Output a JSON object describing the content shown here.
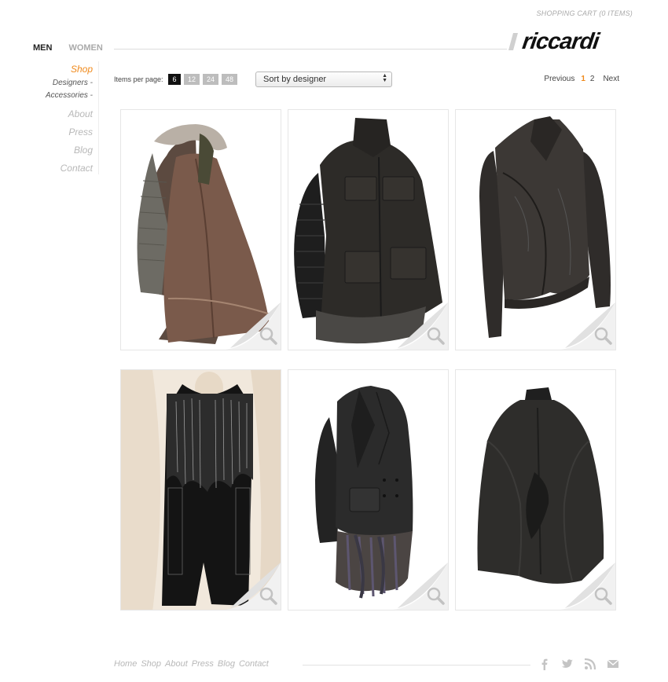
{
  "header": {
    "cart_label": "SHOPPING CART (0 ITEMS)",
    "tabs": [
      {
        "label": "MEN",
        "active": true
      },
      {
        "label": "WOMEN",
        "active": false
      }
    ],
    "logo_text": "riccardi"
  },
  "sidebar": {
    "shop": "Shop",
    "sub_items": [
      "Designers -",
      "Accessories -"
    ],
    "items": [
      "About",
      "Press",
      "Blog",
      "Contact"
    ]
  },
  "toolbar": {
    "ipp_label": "Items per page:",
    "ipp_options": [
      "6",
      "12",
      "24",
      "48"
    ],
    "ipp_selected": "6",
    "sort_value": "Sort by designer",
    "pager": {
      "previous": "Previous",
      "pages": [
        "1",
        "2"
      ],
      "current": "1",
      "next": "Next"
    }
  },
  "products": [
    {
      "garment": "fur-hood-layered-coat",
      "palette": "brown"
    },
    {
      "garment": "utility-jacket-knit-sleeves",
      "palette": "black"
    },
    {
      "garment": "leather-biker-jacket",
      "palette": "dark-gray"
    },
    {
      "garment": "beaded-long-vest",
      "palette": "black"
    },
    {
      "garment": "blazer-with-tulle-skirt",
      "palette": "black"
    },
    {
      "garment": "draped-cape-jacket",
      "palette": "black"
    }
  ],
  "footer": {
    "links": [
      "Home",
      "Shop",
      "About",
      "Press",
      "Blog",
      "Contact"
    ],
    "social": [
      "facebook-icon",
      "twitter-icon",
      "rss-icon",
      "email-icon"
    ]
  },
  "colors": {
    "accent": "#f08a1c",
    "muted": "#b8b8b8",
    "dark": "#111111"
  }
}
